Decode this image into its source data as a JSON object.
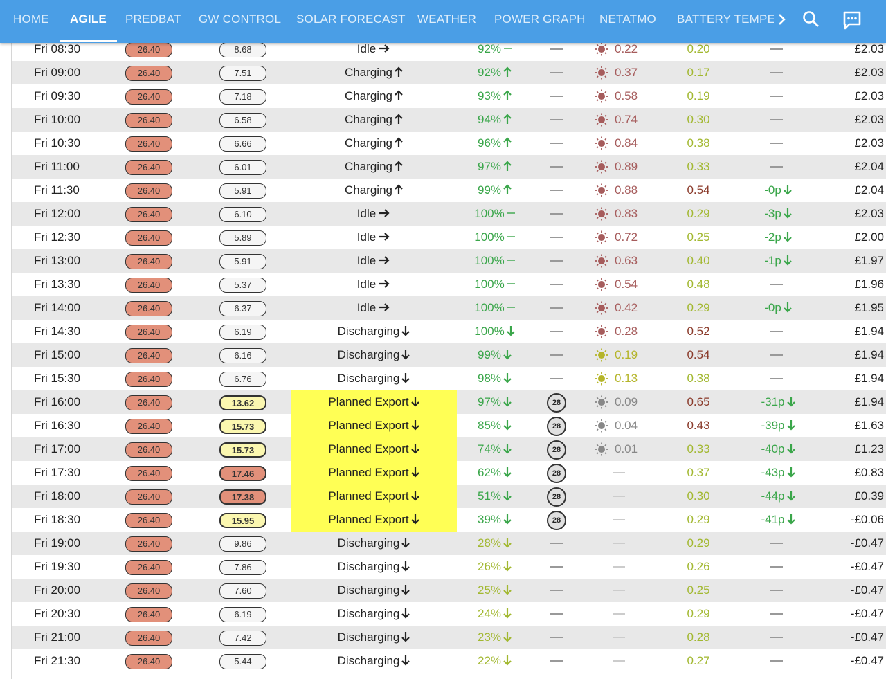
{
  "nav": {
    "tabs": [
      "HOME",
      "AGILE",
      "PREDBAT",
      "GW CONTROL",
      "SOLAR FORECAST",
      "WEATHER",
      "POWER GRAPH",
      "NETATMO",
      "BATTERY TEMPER"
    ],
    "active_tab": "AGILE",
    "icons": [
      "chevron-right-icon",
      "search-icon",
      "chat-icon"
    ]
  },
  "colors": {
    "header": "#4a9ee6",
    "rate_pill": "#e2907a",
    "highlight": "#ffff55",
    "green": "#3aa64a",
    "olive": "#a2b830"
  },
  "rows": [
    {
      "time": "Fri 08:30",
      "rate": "26.40",
      "export": "8.68",
      "state": "Idle",
      "soc": "92%",
      "pv": "0.22",
      "load": "0.20",
      "cost": "",
      "total": "£2.03"
    },
    {
      "time": "Fri 09:00",
      "rate": "26.40",
      "export": "7.51",
      "state": "Charging",
      "soc": "92%",
      "pv": "0.37",
      "load": "0.17",
      "cost": "",
      "total": "£2.03"
    },
    {
      "time": "Fri 09:30",
      "rate": "26.40",
      "export": "7.18",
      "state": "Charging",
      "soc": "93%",
      "pv": "0.58",
      "load": "0.19",
      "cost": "",
      "total": "£2.03"
    },
    {
      "time": "Fri 10:00",
      "rate": "26.40",
      "export": "6.58",
      "state": "Charging",
      "soc": "94%",
      "pv": "0.74",
      "load": "0.30",
      "cost": "",
      "total": "£2.03"
    },
    {
      "time": "Fri 10:30",
      "rate": "26.40",
      "export": "6.66",
      "state": "Charging",
      "soc": "96%",
      "pv": "0.84",
      "load": "0.38",
      "cost": "",
      "total": "£2.03"
    },
    {
      "time": "Fri 11:00",
      "rate": "26.40",
      "export": "6.01",
      "state": "Charging",
      "soc": "97%",
      "pv": "0.89",
      "load": "0.33",
      "cost": "",
      "total": "£2.04"
    },
    {
      "time": "Fri 11:30",
      "rate": "26.40",
      "export": "5.91",
      "state": "Charging",
      "soc": "99%",
      "pv": "0.88",
      "load": "0.54",
      "cost": "-0p",
      "total": "£2.04"
    },
    {
      "time": "Fri 12:00",
      "rate": "26.40",
      "export": "6.10",
      "state": "Idle",
      "soc": "100%",
      "pv": "0.83",
      "load": "0.29",
      "cost": "-3p",
      "total": "£2.03"
    },
    {
      "time": "Fri 12:30",
      "rate": "26.40",
      "export": "5.89",
      "state": "Idle",
      "soc": "100%",
      "pv": "0.72",
      "load": "0.25",
      "cost": "-2p",
      "total": "£2.00"
    },
    {
      "time": "Fri 13:00",
      "rate": "26.40",
      "export": "5.91",
      "state": "Idle",
      "soc": "100%",
      "pv": "0.63",
      "load": "0.40",
      "cost": "-1p",
      "total": "£1.97"
    },
    {
      "time": "Fri 13:30",
      "rate": "26.40",
      "export": "5.37",
      "state": "Idle",
      "soc": "100%",
      "pv": "0.54",
      "load": "0.48",
      "cost": "",
      "total": "£1.96"
    },
    {
      "time": "Fri 14:00",
      "rate": "26.40",
      "export": "6.37",
      "state": "Idle",
      "soc": "100%",
      "pv": "0.42",
      "load": "0.29",
      "cost": "-0p",
      "total": "£1.95"
    },
    {
      "time": "Fri 14:30",
      "rate": "26.40",
      "export": "6.19",
      "state": "Discharging",
      "soc": "100%",
      "pv": "0.28",
      "load": "0.52",
      "cost": "",
      "total": "£1.94"
    },
    {
      "time": "Fri 15:00",
      "rate": "26.40",
      "export": "6.16",
      "state": "Discharging",
      "soc": "99%",
      "pv": "0.19",
      "load": "0.54",
      "cost": "",
      "total": "£1.94"
    },
    {
      "time": "Fri 15:30",
      "rate": "26.40",
      "export": "6.76",
      "state": "Discharging",
      "soc": "98%",
      "pv": "0.13",
      "load": "0.38",
      "cost": "",
      "total": "£1.94"
    },
    {
      "time": "Fri 16:00",
      "rate": "26.40",
      "export": "13.62",
      "state": "Planned Export",
      "soc": "97%",
      "limit": "28",
      "pv": "0.09",
      "load": "0.65",
      "cost": "-31p",
      "total": "£1.94"
    },
    {
      "time": "Fri 16:30",
      "rate": "26.40",
      "export": "15.73",
      "state": "Planned Export",
      "soc": "85%",
      "limit": "28",
      "pv": "0.04",
      "load": "0.43",
      "cost": "-39p",
      "total": "£1.63"
    },
    {
      "time": "Fri 17:00",
      "rate": "26.40",
      "export": "15.73",
      "state": "Planned Export",
      "soc": "74%",
      "limit": "28",
      "pv": "0.01",
      "load": "0.33",
      "cost": "-40p",
      "total": "£1.23"
    },
    {
      "time": "Fri 17:30",
      "rate": "26.40",
      "export": "17.46",
      "state": "Planned Export",
      "soc": "62%",
      "limit": "28",
      "pv": "",
      "load": "0.37",
      "cost": "-43p",
      "total": "£0.83"
    },
    {
      "time": "Fri 18:00",
      "rate": "26.40",
      "export": "17.38",
      "state": "Planned Export",
      "soc": "51%",
      "limit": "28",
      "pv": "",
      "load": "0.30",
      "cost": "-44p",
      "total": "£0.39"
    },
    {
      "time": "Fri 18:30",
      "rate": "26.40",
      "export": "15.95",
      "state": "Planned Export",
      "soc": "39%",
      "limit": "28",
      "pv": "",
      "load": "0.29",
      "cost": "-41p",
      "total": "-£0.06"
    },
    {
      "time": "Fri 19:00",
      "rate": "26.40",
      "export": "9.86",
      "state": "Discharging",
      "soc": "28%",
      "pv": "",
      "load": "0.29",
      "cost": "",
      "total": "-£0.47"
    },
    {
      "time": "Fri 19:30",
      "rate": "26.40",
      "export": "7.86",
      "state": "Discharging",
      "soc": "26%",
      "pv": "",
      "load": "0.26",
      "cost": "",
      "total": "-£0.47"
    },
    {
      "time": "Fri 20:00",
      "rate": "26.40",
      "export": "7.60",
      "state": "Discharging",
      "soc": "25%",
      "pv": "",
      "load": "0.25",
      "cost": "",
      "total": "-£0.47"
    },
    {
      "time": "Fri 20:30",
      "rate": "26.40",
      "export": "6.19",
      "state": "Discharging",
      "soc": "24%",
      "pv": "",
      "load": "0.29",
      "cost": "",
      "total": "-£0.47"
    },
    {
      "time": "Fri 21:00",
      "rate": "26.40",
      "export": "7.42",
      "state": "Discharging",
      "soc": "23%",
      "pv": "",
      "load": "0.28",
      "cost": "",
      "total": "-£0.47"
    },
    {
      "time": "Fri 21:30",
      "rate": "26.40",
      "export": "5.44",
      "state": "Discharging",
      "soc": "22%",
      "pv": "",
      "load": "0.27",
      "cost": "",
      "total": "-£0.47"
    }
  ]
}
